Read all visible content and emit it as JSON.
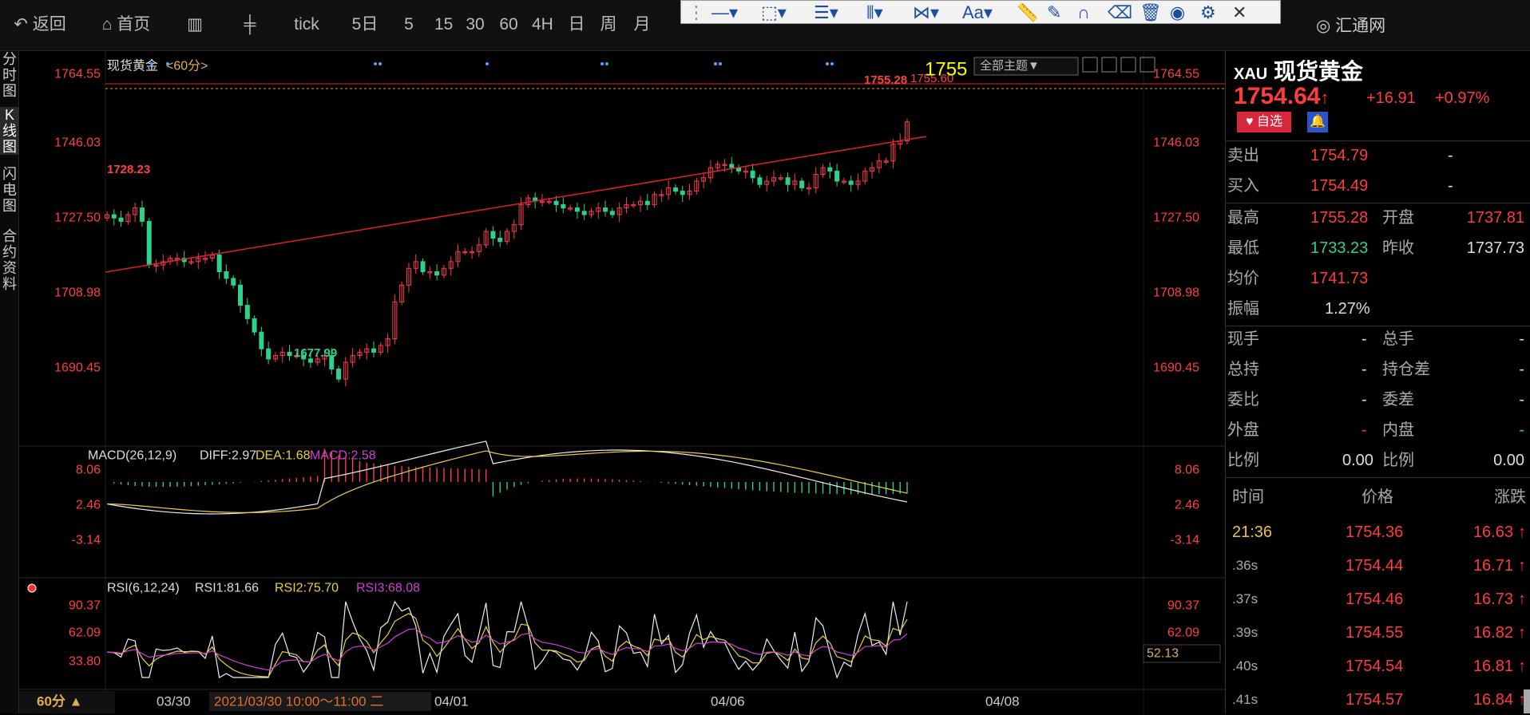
{
  "toolbar": {
    "back": "返回",
    "home": "首页",
    "tick": "tick",
    "periods": [
      "5日",
      "5",
      "15",
      "30",
      "60",
      "4H",
      "日",
      "周",
      "月"
    ],
    "brand": "汇通网",
    "draw_font": "Aa"
  },
  "left_tabs": [
    "分\n时\n图",
    "K\n线\n图",
    "闪\n电\n图",
    "合\n约\n资\n料"
  ],
  "main": {
    "name": "现货黄金",
    "period": "<60分>",
    "theme_button": "全部主题▼",
    "high_label": "1728.23",
    "low_label": "1677.99",
    "price_marker": "1755",
    "right_top_label_1": "1755.28",
    "right_top_label_2": "1755.60"
  },
  "macd": {
    "name": "MACD(26,12,9)",
    "diff": "DIFF:2.97",
    "dea": "DEA:1.68",
    "macd": "MACD:2.58"
  },
  "rsi": {
    "name": "RSI(6,12,24)",
    "rsi1": "RSI1:81.66",
    "rsi2": "RSI2:75.70",
    "rsi3": "RSI3:68.08",
    "current": "52.13"
  },
  "bottom": {
    "period": "60分 ▲",
    "crosshair_time": "2021/03/30 10:00～11:00 二"
  },
  "chart_data": {
    "type": "candlestick",
    "instrument": "XAU 现货黄金",
    "interval": "60分",
    "price_axis": [
      "1764.55",
      "1746.03",
      "1727.50",
      "1708.98",
      "1690.45"
    ],
    "price_range": [
      1683,
      1771
    ],
    "macd_axis": [
      "8.06",
      "2.46",
      "-3.14"
    ],
    "rsi_axis": [
      "90.37",
      "62.09",
      "33.80"
    ],
    "x_ticks": [
      "03/30",
      "04/01",
      "04/06",
      "04/08"
    ],
    "close_path": [
      1727,
      1726,
      1725,
      1727,
      1729,
      1725,
      1712,
      1712,
      1713,
      1714,
      1714,
      1713,
      1713,
      1714,
      1714,
      1715,
      1710,
      1708,
      1706,
      1700,
      1696,
      1692,
      1687,
      1684,
      1685,
      1686,
      1685,
      1685,
      1684,
      1683,
      1684,
      1685,
      1681,
      1678,
      1683,
      1685,
      1686,
      1687,
      1686,
      1688,
      1690,
      1701,
      1706,
      1711,
      1713,
      1710,
      1710,
      1709,
      1711,
      1713,
      1716,
      1716,
      1716,
      1718,
      1722,
      1720,
      1719,
      1722,
      1724,
      1730,
      1732,
      1731,
      1731,
      1731,
      1730,
      1729,
      1729,
      1728,
      1727,
      1728,
      1729,
      1728,
      1727,
      1729,
      1730,
      1730,
      1731,
      1730,
      1733,
      1733,
      1735,
      1734,
      1733,
      1734,
      1737,
      1738,
      1741,
      1742,
      1742,
      1741,
      1740,
      1740,
      1738,
      1736,
      1737,
      1738,
      1738,
      1736,
      1737,
      1735,
      1735,
      1739,
      1741,
      1740,
      1737,
      1737,
      1736,
      1737,
      1740,
      1741,
      1743,
      1743,
      1748,
      1749,
      1754.64
    ]
  }
}
